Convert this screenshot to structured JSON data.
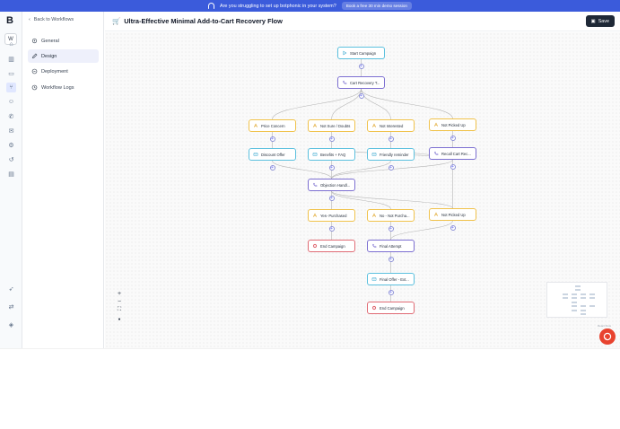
{
  "banner": {
    "text": "Are you struggling to set up botphonic in your system?",
    "cta": "Book a free 30 min demo session"
  },
  "rail": {
    "logo": "B",
    "workspace": "W",
    "icons": [
      "home-icon",
      "book-icon",
      "inbox-icon",
      "workflow-icon",
      "users-icon",
      "phone-icon",
      "mail-icon",
      "settings-icon",
      "history-icon",
      "docs-icon",
      "rocket-icon",
      "swap-icon",
      "shield-icon"
    ]
  },
  "sidebar": {
    "back": "Back to Workflows",
    "items": [
      {
        "label": "General",
        "icon": "gear-icon",
        "active": false
      },
      {
        "label": "Design",
        "icon": "pencil-icon",
        "active": true
      },
      {
        "label": "Deployment",
        "icon": "rocket-icon",
        "active": false
      },
      {
        "label": "Workflow Logs",
        "icon": "history-icon",
        "active": false
      }
    ]
  },
  "header": {
    "title": "Ultra-Effective Minimal Add-to-Cart Recovery Flow",
    "save_label": "Save"
  },
  "flow": {
    "nodes": [
      {
        "id": "start",
        "label": "Start Campaign",
        "kind": "trigger"
      },
      {
        "id": "call1",
        "label": "Cart Recovery T...",
        "kind": "call"
      },
      {
        "id": "c_price",
        "label": "Price Concern",
        "kind": "cond"
      },
      {
        "id": "c_notsure",
        "label": "Not Sure / Doubts",
        "kind": "cond"
      },
      {
        "id": "c_notint",
        "label": "Not Interested",
        "kind": "cond"
      },
      {
        "id": "c_notpick",
        "label": "Not Picked Up",
        "kind": "cond"
      },
      {
        "id": "m_discount",
        "label": "Discount Offer",
        "kind": "msg"
      },
      {
        "id": "m_benefits",
        "label": "Benefits + FAQ",
        "kind": "msg"
      },
      {
        "id": "m_friendly",
        "label": "Friendly reminder",
        "kind": "msg"
      },
      {
        "id": "call_recall",
        "label": "Recall Cart Rec...",
        "kind": "call"
      },
      {
        "id": "call_obj",
        "label": "Objection Handl...",
        "kind": "call"
      },
      {
        "id": "c_yes",
        "label": "Yes- Purchased",
        "kind": "cond"
      },
      {
        "id": "c_no",
        "label": "No - Not Purcha...",
        "kind": "cond"
      },
      {
        "id": "c_notpick2",
        "label": "Not Picked Up",
        "kind": "cond"
      },
      {
        "id": "end1",
        "label": "End Campaign",
        "kind": "end"
      },
      {
        "id": "call_final",
        "label": "Final Attempt",
        "kind": "call"
      },
      {
        "id": "m_final",
        "label": "Final Offer - Ext...",
        "kind": "msg"
      },
      {
        "id": "end2",
        "label": "End Campaign",
        "kind": "end"
      }
    ],
    "edges": [
      [
        "start",
        "call1"
      ],
      [
        "call1",
        "c_price"
      ],
      [
        "call1",
        "c_notsure"
      ],
      [
        "call1",
        "c_notint"
      ],
      [
        "call1",
        "c_notpick"
      ],
      [
        "c_price",
        "m_discount"
      ],
      [
        "c_notsure",
        "m_benefits"
      ],
      [
        "c_notint",
        "m_friendly"
      ],
      [
        "c_notpick",
        "call_recall"
      ],
      [
        "m_discount",
        "call_obj"
      ],
      [
        "m_benefits",
        "call_obj"
      ],
      [
        "m_friendly",
        "call_obj"
      ],
      [
        "call_recall",
        "call_obj"
      ],
      [
        "call_recall",
        "m_benefits"
      ],
      [
        "call_recall",
        "m_friendly"
      ],
      [
        "call_obj",
        "c_yes"
      ],
      [
        "call_obj",
        "c_no"
      ],
      [
        "call_obj",
        "c_notpick2"
      ],
      [
        "c_yes",
        "end1"
      ],
      [
        "c_no",
        "call_final"
      ],
      [
        "c_notpick2",
        "call_final"
      ],
      [
        "call_recall",
        "c_notpick2"
      ],
      [
        "call_final",
        "m_final"
      ],
      [
        "m_final",
        "end2"
      ]
    ]
  },
  "canvas_controls": {
    "zoom_in": "+",
    "zoom_out": "−",
    "fit": "⛶",
    "lock": "●"
  },
  "minimap": {
    "label": "React Flow"
  },
  "colors": {
    "accent": "#3b5bdb",
    "trigger": "#5bc0de",
    "call": "#7c6fd1",
    "condition": "#f0c24b",
    "end": "#e06c75",
    "chat": "#e8432f"
  }
}
